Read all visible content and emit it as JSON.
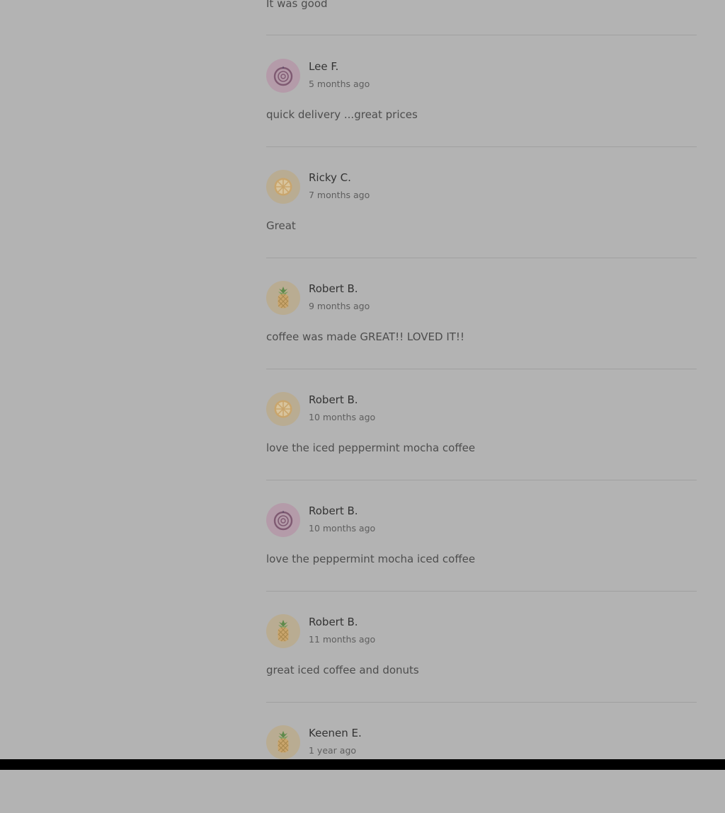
{
  "colors": {
    "page_background": "#b3b3b3",
    "divider": "#a0a0a0",
    "onion_avatar_bg": "#b49ba9",
    "citrus_avatar_bg": "#b9ac92",
    "pineapple_avatar_bg": "#b9ac92"
  },
  "previous_review": {
    "text": "It was good"
  },
  "reviews": [
    {
      "name": "Lee F.",
      "time": "5 months ago",
      "text": "quick delivery ...great prices",
      "avatar_icon": "onion-icon"
    },
    {
      "name": "Ricky C.",
      "time": "7 months ago",
      "text": "Great",
      "avatar_icon": "citrus-slice-icon"
    },
    {
      "name": "Robert B.",
      "time": "9 months ago",
      "text": "coffee was made GREAT!! LOVED IT!!",
      "avatar_icon": "pineapple-icon"
    },
    {
      "name": "Robert B.",
      "time": "10 months ago",
      "text": "love the iced peppermint mocha coffee",
      "avatar_icon": "citrus-slice-icon"
    },
    {
      "name": "Robert B.",
      "time": "10 months ago",
      "text": "love the peppermint mocha iced coffee",
      "avatar_icon": "onion-icon"
    },
    {
      "name": "Robert B.",
      "time": "11 months ago",
      "text": "great iced coffee and donuts",
      "avatar_icon": "pineapple-icon"
    },
    {
      "name": "Keenen E.",
      "time": "1 year ago",
      "text": "",
      "avatar_icon": "pineapple-icon"
    }
  ]
}
